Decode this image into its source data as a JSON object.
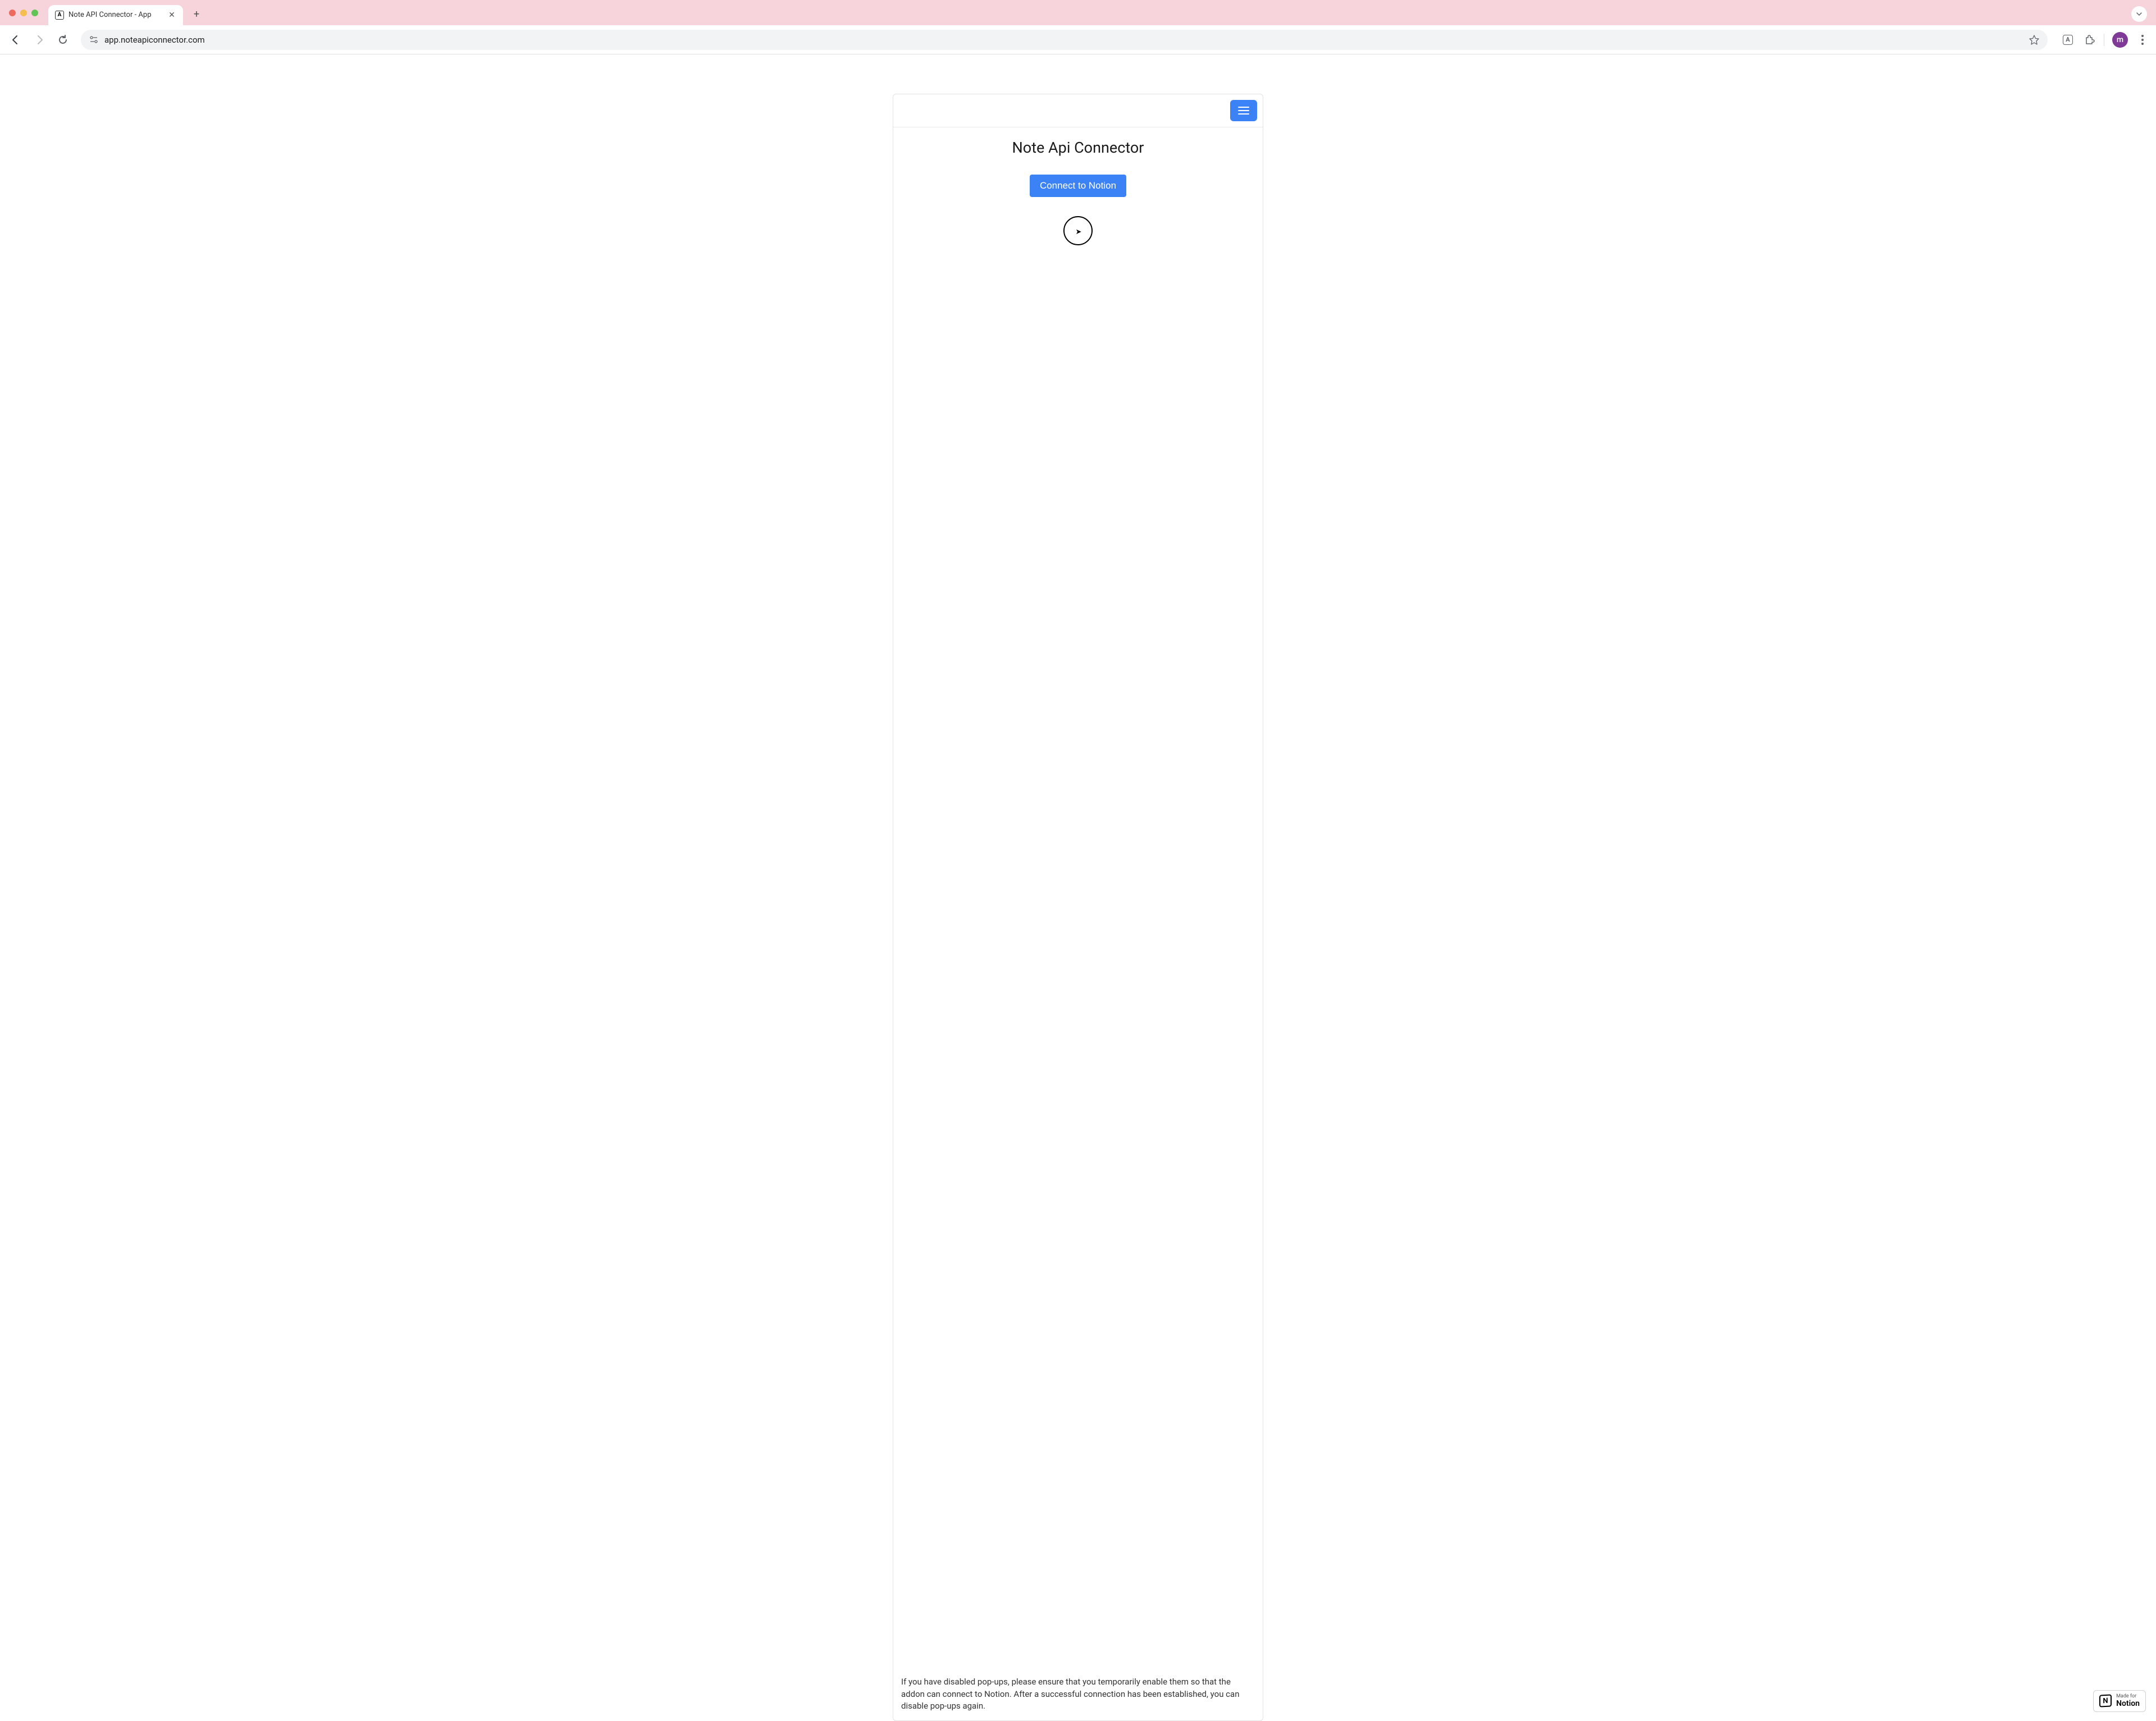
{
  "browser": {
    "tab_title": "Note API Connector - App",
    "url": "app.noteapiconnector.com",
    "avatar_letter": "m"
  },
  "app": {
    "title": "Note Api Connector",
    "connect_button_label": "Connect to Notion",
    "footer_text": "If you have disabled pop-ups, please ensure that you temporarily enable them so that the addon can connect to Notion. After a successful connection has been established, you can disable pop-ups again."
  },
  "badge": {
    "logo_letter": "N",
    "line1": "Made for",
    "line2": "Notion"
  }
}
